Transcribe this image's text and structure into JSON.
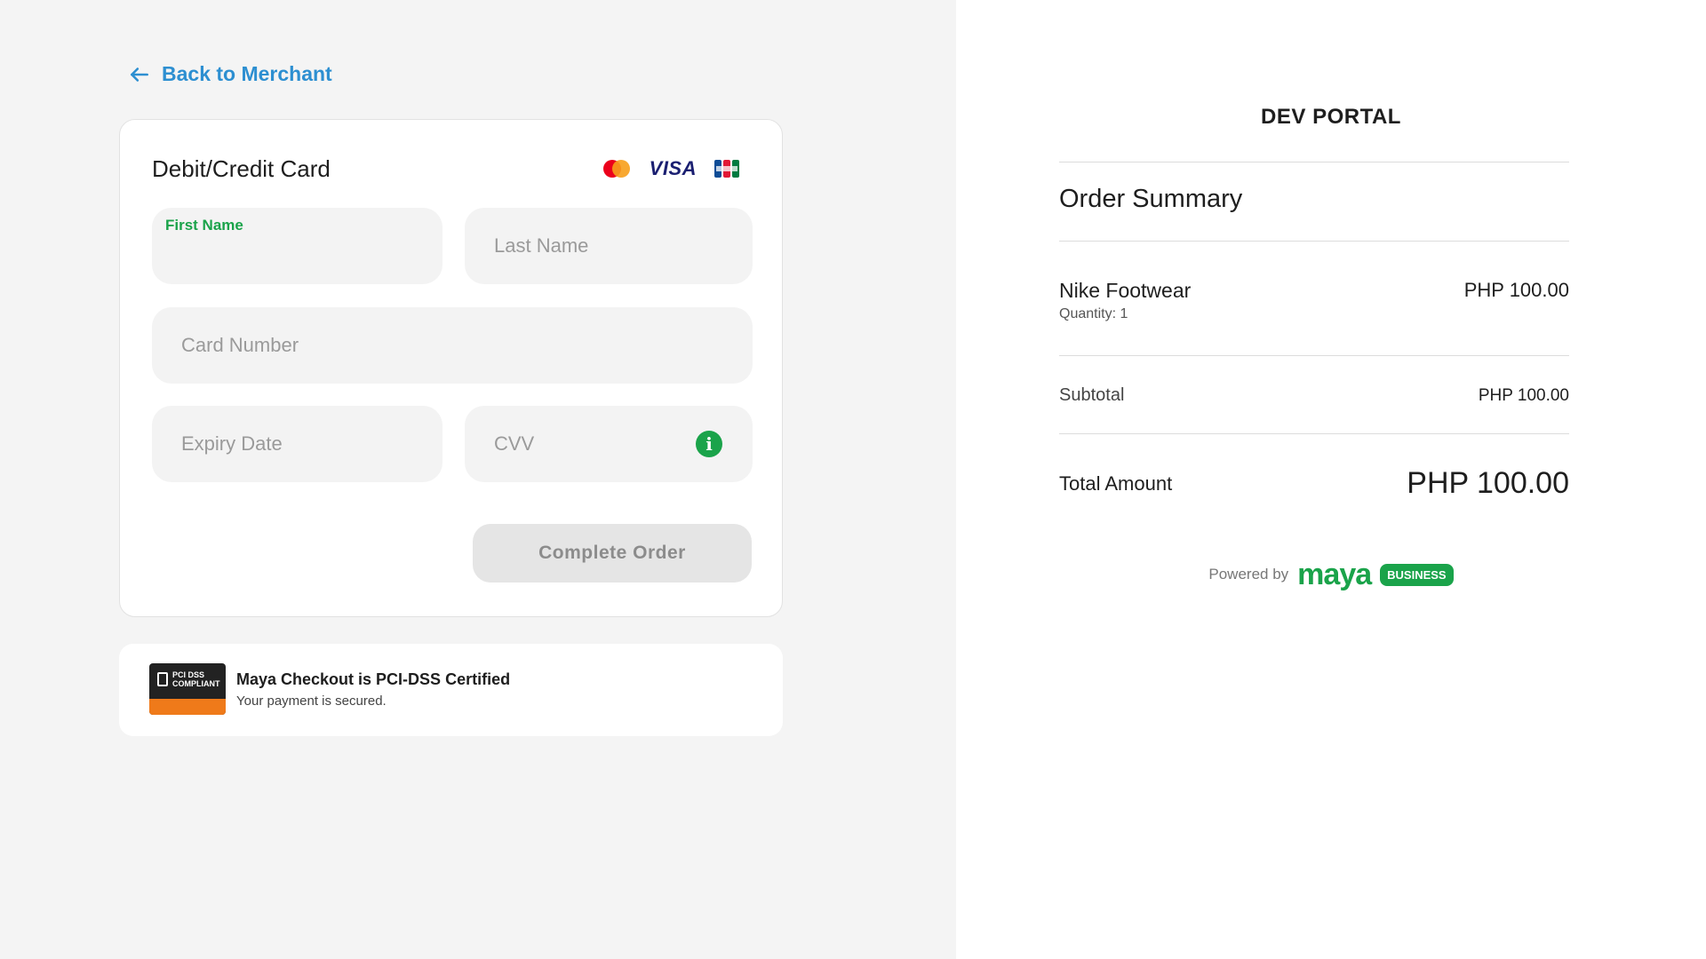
{
  "nav": {
    "back_label": "Back to Merchant"
  },
  "card_form": {
    "title": "Debit/Credit Card",
    "brands": {
      "visa_label": "VISA",
      "mastercard": "mastercard-icon",
      "jcb": "jcb-icon"
    },
    "first_name": {
      "label": "First Name",
      "value": ""
    },
    "last_name": {
      "placeholder": "Last Name"
    },
    "card_number": {
      "placeholder": "Card Number"
    },
    "expiry": {
      "placeholder": "Expiry Date"
    },
    "cvv": {
      "placeholder": "CVV",
      "info_icon": "info-icon"
    },
    "submit_label": "Complete Order"
  },
  "pci": {
    "badge_line1": "PCI DSS",
    "badge_line2": "COMPLIANT",
    "title": "Maya Checkout is PCI-DSS Certified",
    "subtitle": "Your payment is secured."
  },
  "summary": {
    "merchant": "DEV PORTAL",
    "title": "Order Summary",
    "item": {
      "name": "Nike Footwear",
      "quantity": "Quantity: 1",
      "price": "PHP 100.00"
    },
    "subtotal_label": "Subtotal",
    "subtotal_value": "PHP 100.00",
    "total_label": "Total Amount",
    "total_value": "PHP 100.00"
  },
  "footer": {
    "powered_by": "Powered by",
    "brand": "maya",
    "brand_tag": "BUSINESS"
  },
  "colors": {
    "accent_green": "#1aa34a",
    "link_blue": "#2d8fd1",
    "pci_orange": "#ef7a1a"
  }
}
